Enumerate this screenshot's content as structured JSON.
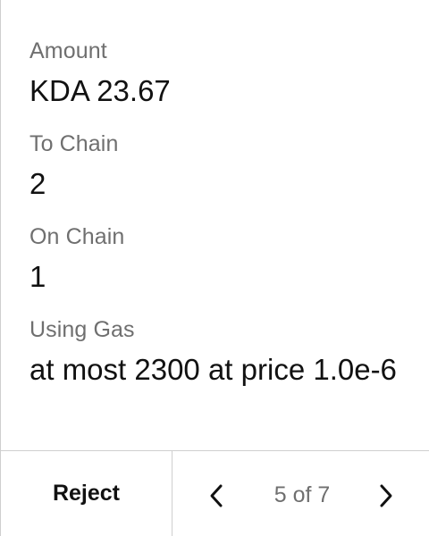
{
  "fields": {
    "amount": {
      "label": "Amount",
      "value": "KDA 23.67"
    },
    "to_chain": {
      "label": "To Chain",
      "value": "2"
    },
    "on_chain": {
      "label": "On Chain",
      "value": "1"
    },
    "using_gas": {
      "label": "Using Gas",
      "value": "at most 2300 at price 1.0e-6"
    }
  },
  "footer": {
    "reject_label": "Reject",
    "page_indicator": "5 of 7",
    "prev_icon": "chevron-left-icon",
    "next_icon": "chevron-right-icon"
  },
  "colors": {
    "label": "#6f6f6f",
    "value": "#111111",
    "divider": "#cfcfcf"
  }
}
